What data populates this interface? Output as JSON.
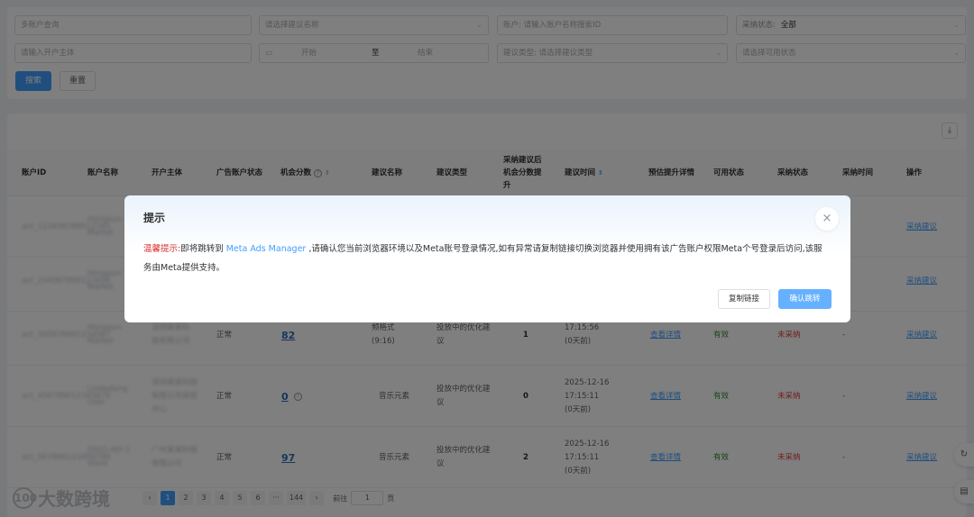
{
  "filters": {
    "multi_account_query": "多账户查询",
    "suggestion_name_select": "请选择建议名称",
    "account_label": "账户:",
    "account_placeholder": "请输入账户名称搜索ID",
    "adopt_status_label": "采纳状态:",
    "adopt_status_value": "全部",
    "opener_placeholder": "请输入开户主体",
    "date_start": "开始",
    "date_to": "至",
    "date_end": "结束",
    "suggest_type_label": "建议类型:",
    "suggest_type_placeholder": "请选择建议类型",
    "usable_status_placeholder": "请选择可用状态",
    "search_button": "搜索",
    "reset_button": "重置"
  },
  "table": {
    "headers": {
      "account_id": "账户ID",
      "account_name": "账户名称",
      "opener": "开户主体",
      "ad_account_status": "广告账户状态",
      "opportunity_score": "机会分数",
      "suggestion_name": "建议名称",
      "suggestion_type": "建议类型",
      "score_gain": "采纳建议后机会分数提升",
      "suggestion_time": "建议时间",
      "expected_gain": "预估提升详情",
      "usable_status": "可用状态",
      "adopt_status": "采纳状态",
      "adopt_time": "采纳时间",
      "actions": "操作"
    },
    "rows": [
      {
        "account_id": "act_123456789012345",
        "account_name": "Hongsun Market",
        "opener": "",
        "ad_status": "",
        "score": "",
        "suggestion_name": "",
        "suggestion_type": "",
        "gain": "",
        "time": "",
        "detail": "",
        "usable": "",
        "adopt": "",
        "adopt_time": "",
        "action": "采纳建议"
      },
      {
        "account_id": "act_234567890123456",
        "account_name": "Hongsun Market",
        "opener": "",
        "ad_status": "",
        "score": "",
        "suggestion_name": "",
        "suggestion_type": "",
        "gain": "",
        "time": "",
        "detail": "",
        "usable": "",
        "adopt": "",
        "adopt_time": "",
        "action": "采纳建议"
      },
      {
        "account_id": "act_345678901234567",
        "account_name": "Hongsun Market",
        "opener": "深圳某某科技有限公司",
        "ad_status": "正常",
        "score": "82",
        "suggestion_name_1": "频格式",
        "suggestion_name_2": "(9:16)",
        "suggestion_type": "投放中的优化建议",
        "gain": "1",
        "time_1": "17:15:56",
        "time_2": "(0天前)",
        "detail": "查看详情",
        "usable": "有效",
        "adopt": "未采纳",
        "adopt_time": "-",
        "action": "采纳建议"
      },
      {
        "account_id": "act_456789012345678",
        "account_name": "Lindadang User",
        "opener": "深圳某某科技有限公司商贸中心",
        "ad_status": "正常",
        "score": "0",
        "suggestion_name": "音乐元素",
        "suggestion_type": "投放中的优化建议",
        "gain": "0",
        "time_1": "2025-12-16",
        "time_2": "17:15:11",
        "time_3": "(0天前)",
        "detail": "查看详情",
        "usable": "有效",
        "adopt": "未采纳",
        "adopt_time": "-",
        "action": "采纳建议"
      },
      {
        "account_id": "act_567890123456789",
        "account_name": "DSS1-HJY-1 Store",
        "opener": "广州某某科技有限公司",
        "ad_status": "正常",
        "score": "97",
        "suggestion_name": "音乐元素",
        "suggestion_type": "投放中的优化建议",
        "gain": "2",
        "time_1": "2025-12-16",
        "time_2": "17:15:11",
        "time_3": "(0天前)",
        "detail": "查看详情",
        "usable": "有效",
        "adopt": "未采纳",
        "adopt_time": "-",
        "action": "采纳建议"
      }
    ]
  },
  "pagination": {
    "pages": [
      "1",
      "2",
      "3",
      "4",
      "5",
      "6",
      "···",
      "144"
    ],
    "goto_label": "前往",
    "goto_value": "1",
    "page_unit": "页"
  },
  "dialog": {
    "title": "提示",
    "warn_label": "温馨提示:",
    "text_1": "即将跳转到 ",
    "link_text": "Meta Ads Manager",
    "text_2": " ,请确认您当前浏览器环境以及Meta账号登录情况,如有异常请复制链接切换浏览器并使用拥有该广告账户权限Meta个号登录后访问,该服务由Meta提供支持。",
    "copy_button": "复制链接",
    "confirm_button": "确认跳转",
    "close_icon": "×"
  },
  "watermark": {
    "text": "大数跨境",
    "logo_text": "100"
  },
  "icons": {
    "download": "download-icon",
    "close": "close-icon",
    "help": "question-circle-icon",
    "info": "info-circle-icon"
  }
}
